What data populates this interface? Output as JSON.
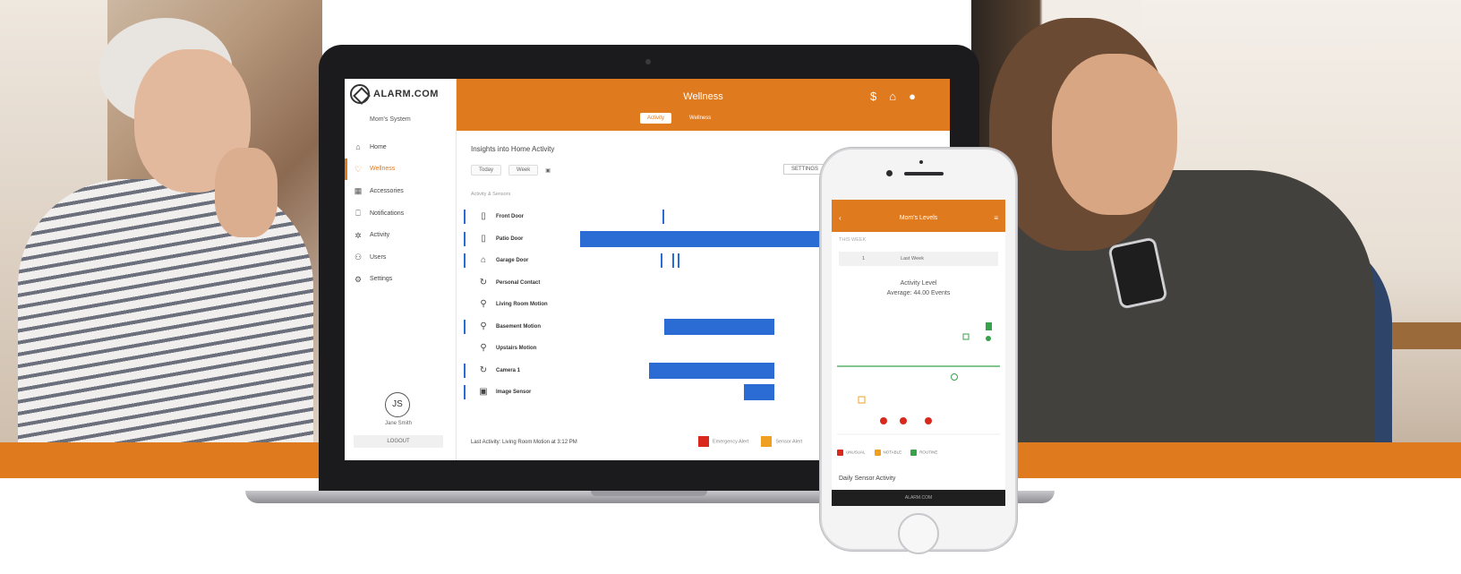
{
  "laptop_app": {
    "logo_text": "ALARM.COM",
    "system_name": "Mom's System",
    "nav": [
      {
        "label": "Home",
        "icon": "home-icon",
        "glyph": "⌂"
      },
      {
        "label": "Wellness",
        "icon": "heart-icon",
        "glyph": "♡"
      },
      {
        "label": "Accessories",
        "icon": "grid-icon",
        "glyph": "▦"
      },
      {
        "label": "Notifications",
        "icon": "bell-icon",
        "glyph": "⎕"
      },
      {
        "label": "Activity",
        "icon": "activity-icon",
        "glyph": "✲"
      },
      {
        "label": "Users",
        "icon": "users-icon",
        "glyph": "⚇"
      },
      {
        "label": "Settings",
        "icon": "gear-icon",
        "glyph": "⚙"
      }
    ],
    "avatar_initials": "JS",
    "user_name": "Jane Smith",
    "logout_label": "LOGOUT",
    "header_title": "Wellness",
    "tabs": [
      "Activity",
      "Wellness"
    ],
    "content_title": "Insights into Home Activity",
    "filters": {
      "range": "Today",
      "period": "Week"
    },
    "settings_label": "SETTINGS",
    "column_header": "Activity & Sensors",
    "rows": [
      {
        "label": "Front Door",
        "glyph": "▯"
      },
      {
        "label": "Patio Door",
        "glyph": "▯"
      },
      {
        "label": "Garage Door",
        "glyph": "⌂"
      },
      {
        "label": "Personal Contact",
        "glyph": "↻"
      },
      {
        "label": "Living Room Motion",
        "glyph": "⚲"
      },
      {
        "label": "Basement Motion",
        "glyph": "⚲"
      },
      {
        "label": "Upstairs Motion",
        "glyph": "⚲"
      },
      {
        "label": "Camera 1",
        "glyph": "↻"
      },
      {
        "label": "Image Sensor",
        "glyph": "▣"
      }
    ],
    "last_activity": "Last Activity: Living Room Motion at 3:12 PM",
    "legend": [
      {
        "label": "Emergency Alert",
        "color": "#d9281c"
      },
      {
        "label": "Sensor Alert",
        "color": "#f0a020"
      }
    ],
    "colors": {
      "accent": "#e07a1f",
      "bar": "#2a6cd4"
    }
  },
  "phone_app": {
    "header_title": "Mom's Levels",
    "sub_label": "THIS WEEK",
    "filter_left": "1",
    "filter_right": "Last Week",
    "chart_title_line1": "Activity Level",
    "chart_title_line2": "Average: 44.00 Events",
    "legend": [
      {
        "label": "UNUSUAL",
        "color": "#d9281c"
      },
      {
        "label": "NOTABLE",
        "color": "#f0a020"
      },
      {
        "label": "ROUTINE",
        "color": "#37a24a"
      }
    ],
    "section_title": "Daily Sensor Activity",
    "footer_brand": "ALARM.COM"
  }
}
